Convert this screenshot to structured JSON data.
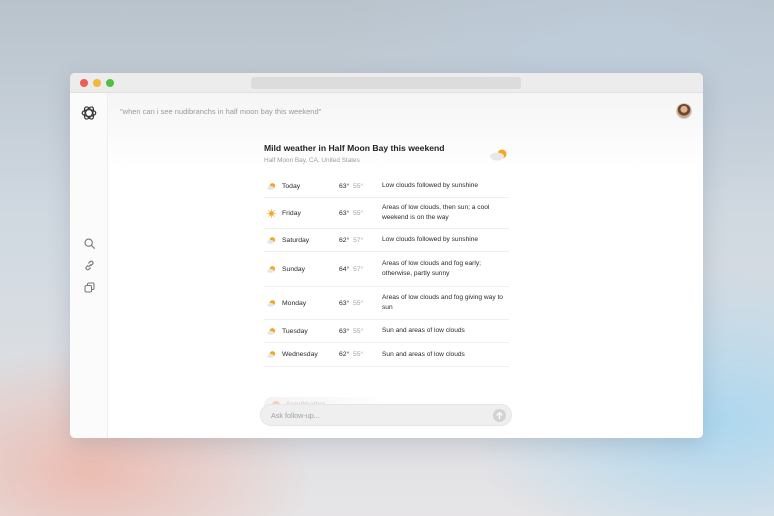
{
  "window": {
    "controls": [
      "close",
      "minimize",
      "maximize"
    ]
  },
  "sidebar": {
    "logo_icon": "openai-logo-icon",
    "items": [
      {
        "icon": "search-icon"
      },
      {
        "icon": "link-icon"
      },
      {
        "icon": "copy-icon"
      }
    ]
  },
  "header": {
    "query": "\"when can i see nudibranchs in half moon bay this weekend\"",
    "avatar": "avatar"
  },
  "card": {
    "title": "Mild weather in Half Moon Bay this weekend",
    "location": "Half Moon Bay, CA, United States",
    "icon": "partly-cloudy-icon"
  },
  "forecast": [
    {
      "day": "Today",
      "high": "63°",
      "low": "55°",
      "desc": "Low clouds followed by sunshine",
      "icon": "partly-sunny-icon"
    },
    {
      "day": "Friday",
      "high": "63°",
      "low": "55°",
      "desc": "Areas of low clouds, then sun; a cool weekend is on the way",
      "icon": "sunny-icon"
    },
    {
      "day": "Saturday",
      "high": "62°",
      "low": "57°",
      "desc": "Low clouds followed by sunshine",
      "icon": "partly-sunny-icon"
    },
    {
      "day": "Sunday",
      "high": "64°",
      "low": "57°",
      "desc": "Areas of low clouds and fog early; otherwise, partly sunny",
      "icon": "partly-sunny-icon"
    },
    {
      "day": "Monday",
      "high": "63°",
      "low": "55°",
      "desc": "Areas of low clouds and fog giving way to sun",
      "icon": "partly-sunny-icon"
    },
    {
      "day": "Tuesday",
      "high": "63°",
      "low": "55°",
      "desc": "Sun and areas of low clouds",
      "icon": "partly-sunny-icon"
    },
    {
      "day": "Wednesday",
      "high": "62°",
      "low": "55°",
      "desc": "Sun and areas of low clouds",
      "icon": "partly-sunny-icon"
    }
  ],
  "faded_item": {
    "label": "AccuWeather"
  },
  "followup": {
    "placeholder": "Ask follow-up...",
    "send_icon": "send-arrow-icon"
  },
  "colors": {
    "sun": "#f5a623",
    "cloud": "#e8e8e8",
    "close": "#ee5c55",
    "minimize": "#f2b83a",
    "maximize": "#4fc046"
  }
}
